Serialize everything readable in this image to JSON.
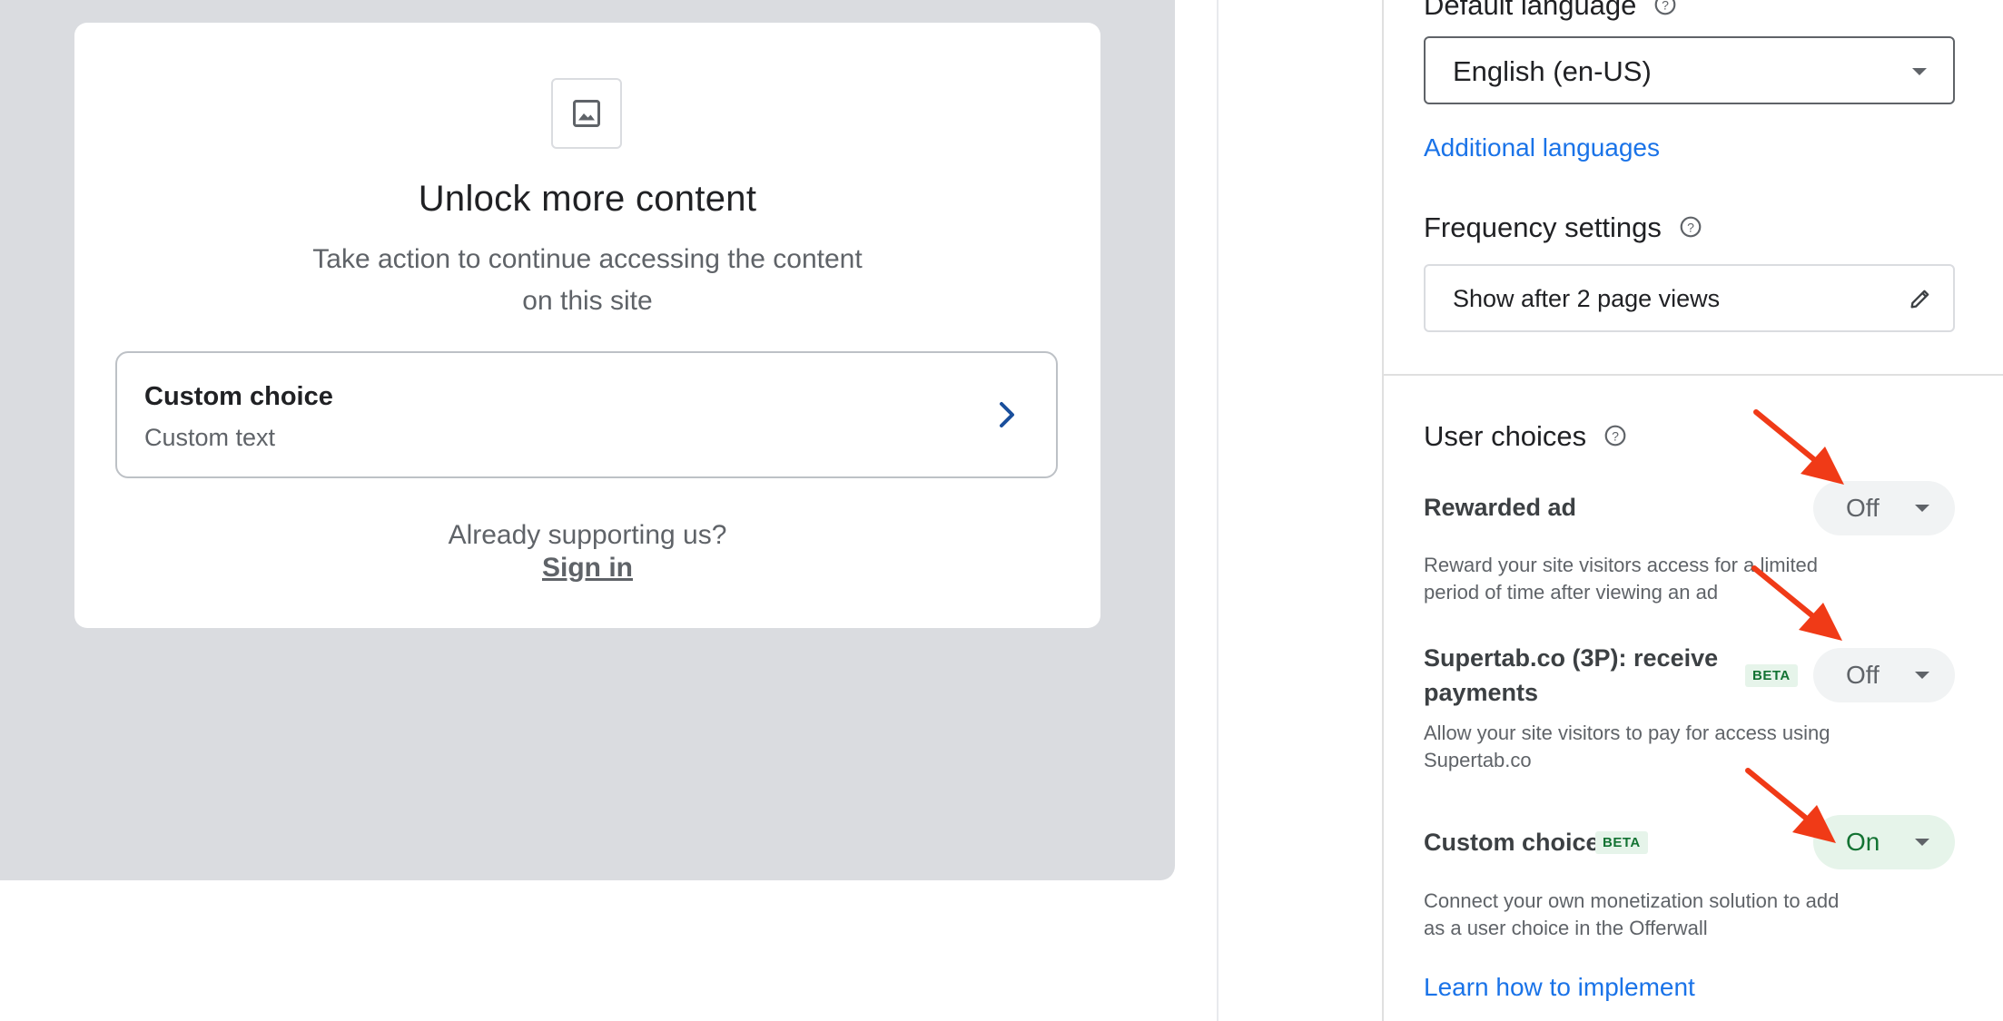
{
  "preview": {
    "image_icon": "image-icon",
    "title": "Unlock more content",
    "subtitle": "Take action to continue accessing the content on this site",
    "choice": {
      "title": "Custom choice",
      "text": "Custom text",
      "chevron_icon": "chevron-right-icon"
    },
    "already_supporting": "Already supporting us?",
    "sign_in": "Sign in"
  },
  "settings": {
    "default_language": {
      "label": "Default language",
      "value": "English (en-US)"
    },
    "additional_languages_link": "Additional languages",
    "frequency": {
      "label": "Frequency settings",
      "value": "Show after 2 page views",
      "edit_icon": "pencil-icon"
    },
    "user_choices": {
      "label": "User choices",
      "items": [
        {
          "label": "Rewarded ad",
          "description": "Reward your site visitors access for a limited period of time after viewing an ad",
          "state": "Off",
          "beta": ""
        },
        {
          "label": "Supertab.co (3P): receive payments",
          "description": "Allow your site visitors to pay for access using Supertab.co",
          "state": "Off",
          "beta": "BETA"
        },
        {
          "label": "Custom choice",
          "description": "Connect your own monetization solution to add as a user choice in the Offerwall",
          "state": "On",
          "beta": "BETA"
        }
      ]
    },
    "learn_link": "Learn how to implement"
  },
  "colors": {
    "link": "#1a73e8",
    "on_green": "#137333",
    "on_bg": "#e6f4ea",
    "off_bg": "#f1f3f4",
    "annotation_arrow": "#f03a17"
  }
}
